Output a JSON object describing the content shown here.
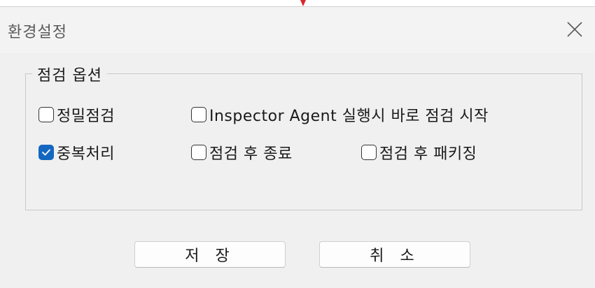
{
  "window": {
    "title": "환경설정",
    "close_icon": "close-icon"
  },
  "group": {
    "label": "점검 옵션"
  },
  "options": {
    "precise_check": {
      "label": "정밀점검",
      "checked": false
    },
    "agent_start": {
      "label": "Inspector Agent 실행시 바로 점검 시작",
      "checked": false
    },
    "duplicate": {
      "label": "중복처리",
      "checked": true
    },
    "exit_after": {
      "label": "점검 후 종료",
      "checked": false
    },
    "packaging_after": {
      "label": "점검 후 패키징",
      "checked": false
    }
  },
  "buttons": {
    "save": "저 장",
    "cancel": "취 소"
  },
  "colors": {
    "accent": "#1467c0",
    "background": "#f0f0f0",
    "marker": "#d9262c"
  }
}
